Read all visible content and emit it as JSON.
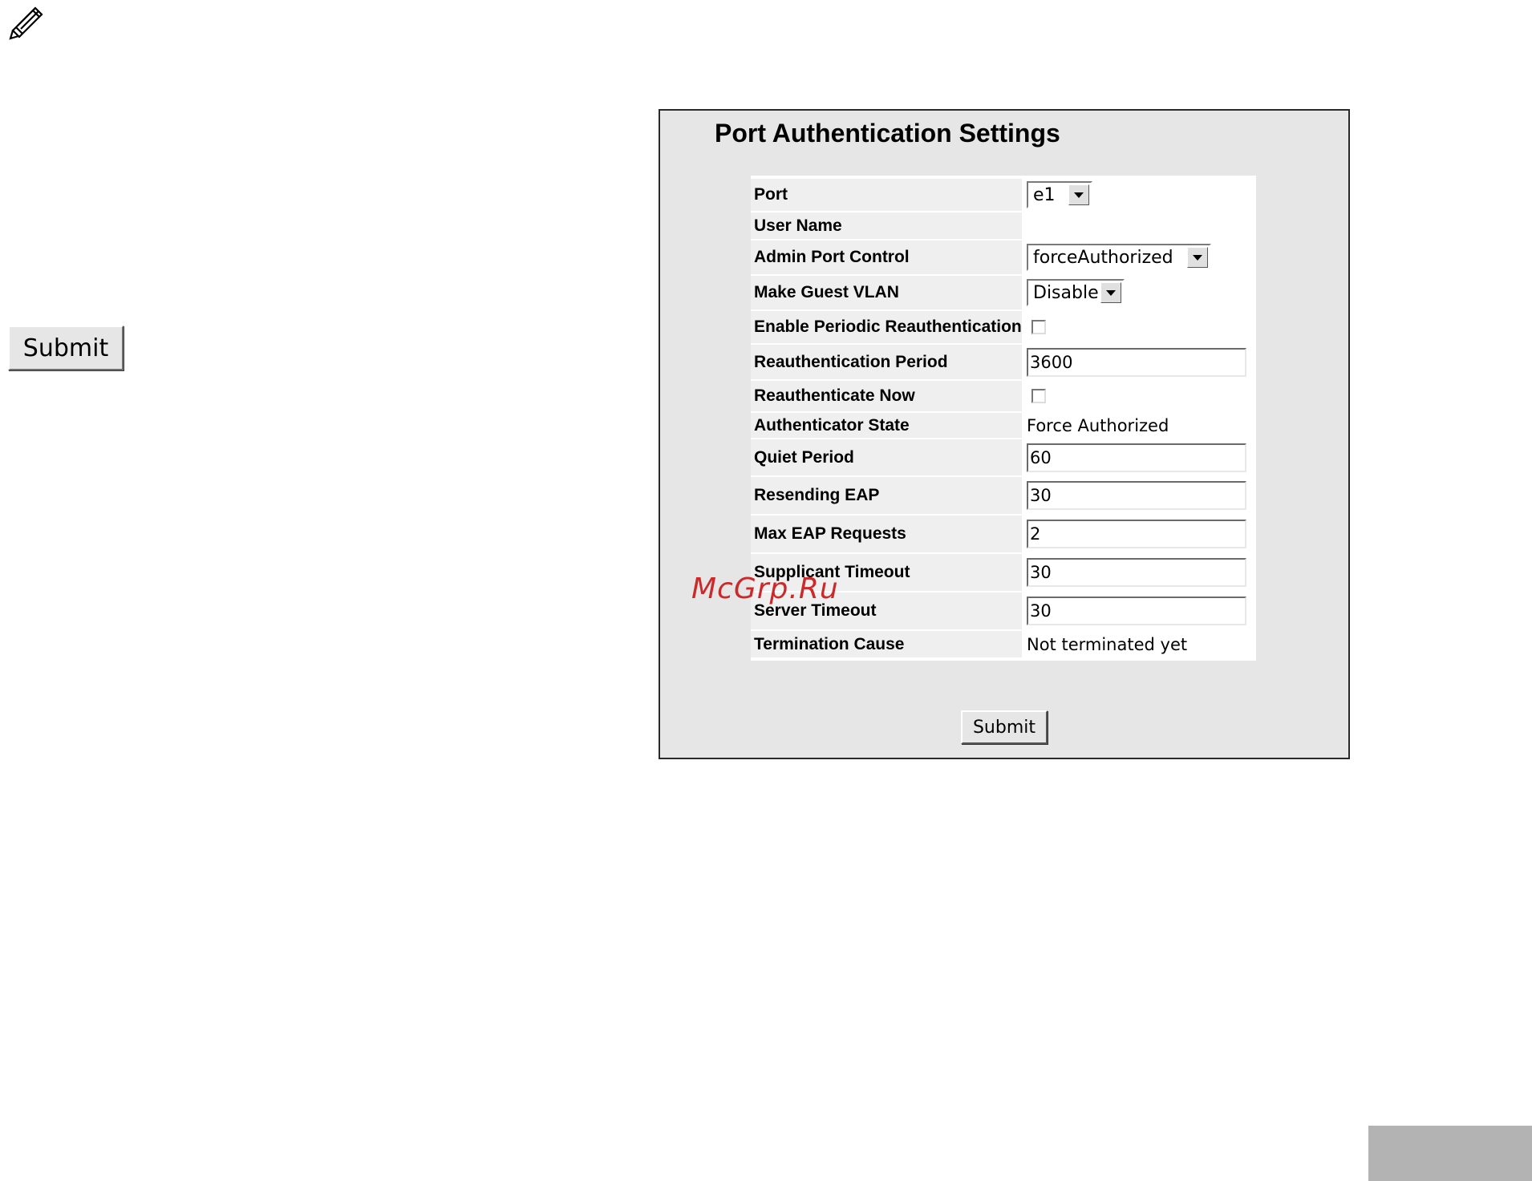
{
  "side_submit_label": "Submit",
  "panel": {
    "title": "Port Authentication Settings",
    "rows": [
      {
        "label": "Port",
        "value": "e1"
      },
      {
        "label": "User Name",
        "value": ""
      },
      {
        "label": "Admin Port Control",
        "value": "forceAuthorized"
      },
      {
        "label": "Make Guest VLAN",
        "value": "Disable"
      },
      {
        "label": "Enable Periodic Reauthentication",
        "value": ""
      },
      {
        "label": "Reauthentication Period",
        "value": "3600"
      },
      {
        "label": "Reauthenticate Now",
        "value": ""
      },
      {
        "label": "Authenticator State",
        "value": "Force Authorized"
      },
      {
        "label": "Quiet Period",
        "value": "60"
      },
      {
        "label": "Resending EAP",
        "value": "30"
      },
      {
        "label": "Max EAP Requests",
        "value": "2"
      },
      {
        "label": "Supplicant Timeout",
        "value": "30"
      },
      {
        "label": "Server Timeout",
        "value": "30"
      },
      {
        "label": "Termination Cause",
        "value": "Not terminated yet"
      }
    ],
    "submit_label": "Submit"
  },
  "watermark": "McGrp.Ru",
  "icons": {
    "top_left": "pencil-icon"
  }
}
